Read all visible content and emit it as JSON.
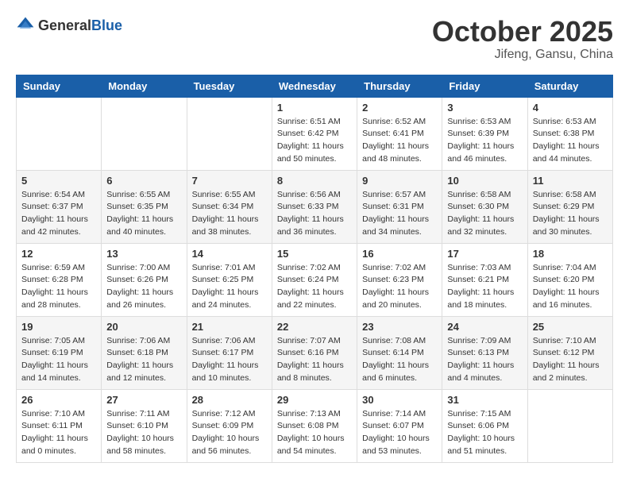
{
  "header": {
    "logo_general": "General",
    "logo_blue": "Blue",
    "month": "October 2025",
    "location": "Jifeng, Gansu, China"
  },
  "weekdays": [
    "Sunday",
    "Monday",
    "Tuesday",
    "Wednesday",
    "Thursday",
    "Friday",
    "Saturday"
  ],
  "weeks": [
    [
      {
        "day": "",
        "sunrise": "",
        "sunset": "",
        "daylight": ""
      },
      {
        "day": "",
        "sunrise": "",
        "sunset": "",
        "daylight": ""
      },
      {
        "day": "",
        "sunrise": "",
        "sunset": "",
        "daylight": ""
      },
      {
        "day": "1",
        "sunrise": "Sunrise: 6:51 AM",
        "sunset": "Sunset: 6:42 PM",
        "daylight": "Daylight: 11 hours and 50 minutes."
      },
      {
        "day": "2",
        "sunrise": "Sunrise: 6:52 AM",
        "sunset": "Sunset: 6:41 PM",
        "daylight": "Daylight: 11 hours and 48 minutes."
      },
      {
        "day": "3",
        "sunrise": "Sunrise: 6:53 AM",
        "sunset": "Sunset: 6:39 PM",
        "daylight": "Daylight: 11 hours and 46 minutes."
      },
      {
        "day": "4",
        "sunrise": "Sunrise: 6:53 AM",
        "sunset": "Sunset: 6:38 PM",
        "daylight": "Daylight: 11 hours and 44 minutes."
      }
    ],
    [
      {
        "day": "5",
        "sunrise": "Sunrise: 6:54 AM",
        "sunset": "Sunset: 6:37 PM",
        "daylight": "Daylight: 11 hours and 42 minutes."
      },
      {
        "day": "6",
        "sunrise": "Sunrise: 6:55 AM",
        "sunset": "Sunset: 6:35 PM",
        "daylight": "Daylight: 11 hours and 40 minutes."
      },
      {
        "day": "7",
        "sunrise": "Sunrise: 6:55 AM",
        "sunset": "Sunset: 6:34 PM",
        "daylight": "Daylight: 11 hours and 38 minutes."
      },
      {
        "day": "8",
        "sunrise": "Sunrise: 6:56 AM",
        "sunset": "Sunset: 6:33 PM",
        "daylight": "Daylight: 11 hours and 36 minutes."
      },
      {
        "day": "9",
        "sunrise": "Sunrise: 6:57 AM",
        "sunset": "Sunset: 6:31 PM",
        "daylight": "Daylight: 11 hours and 34 minutes."
      },
      {
        "day": "10",
        "sunrise": "Sunrise: 6:58 AM",
        "sunset": "Sunset: 6:30 PM",
        "daylight": "Daylight: 11 hours and 32 minutes."
      },
      {
        "day": "11",
        "sunrise": "Sunrise: 6:58 AM",
        "sunset": "Sunset: 6:29 PM",
        "daylight": "Daylight: 11 hours and 30 minutes."
      }
    ],
    [
      {
        "day": "12",
        "sunrise": "Sunrise: 6:59 AM",
        "sunset": "Sunset: 6:28 PM",
        "daylight": "Daylight: 11 hours and 28 minutes."
      },
      {
        "day": "13",
        "sunrise": "Sunrise: 7:00 AM",
        "sunset": "Sunset: 6:26 PM",
        "daylight": "Daylight: 11 hours and 26 minutes."
      },
      {
        "day": "14",
        "sunrise": "Sunrise: 7:01 AM",
        "sunset": "Sunset: 6:25 PM",
        "daylight": "Daylight: 11 hours and 24 minutes."
      },
      {
        "day": "15",
        "sunrise": "Sunrise: 7:02 AM",
        "sunset": "Sunset: 6:24 PM",
        "daylight": "Daylight: 11 hours and 22 minutes."
      },
      {
        "day": "16",
        "sunrise": "Sunrise: 7:02 AM",
        "sunset": "Sunset: 6:23 PM",
        "daylight": "Daylight: 11 hours and 20 minutes."
      },
      {
        "day": "17",
        "sunrise": "Sunrise: 7:03 AM",
        "sunset": "Sunset: 6:21 PM",
        "daylight": "Daylight: 11 hours and 18 minutes."
      },
      {
        "day": "18",
        "sunrise": "Sunrise: 7:04 AM",
        "sunset": "Sunset: 6:20 PM",
        "daylight": "Daylight: 11 hours and 16 minutes."
      }
    ],
    [
      {
        "day": "19",
        "sunrise": "Sunrise: 7:05 AM",
        "sunset": "Sunset: 6:19 PM",
        "daylight": "Daylight: 11 hours and 14 minutes."
      },
      {
        "day": "20",
        "sunrise": "Sunrise: 7:06 AM",
        "sunset": "Sunset: 6:18 PM",
        "daylight": "Daylight: 11 hours and 12 minutes."
      },
      {
        "day": "21",
        "sunrise": "Sunrise: 7:06 AM",
        "sunset": "Sunset: 6:17 PM",
        "daylight": "Daylight: 11 hours and 10 minutes."
      },
      {
        "day": "22",
        "sunrise": "Sunrise: 7:07 AM",
        "sunset": "Sunset: 6:16 PM",
        "daylight": "Daylight: 11 hours and 8 minutes."
      },
      {
        "day": "23",
        "sunrise": "Sunrise: 7:08 AM",
        "sunset": "Sunset: 6:14 PM",
        "daylight": "Daylight: 11 hours and 6 minutes."
      },
      {
        "day": "24",
        "sunrise": "Sunrise: 7:09 AM",
        "sunset": "Sunset: 6:13 PM",
        "daylight": "Daylight: 11 hours and 4 minutes."
      },
      {
        "day": "25",
        "sunrise": "Sunrise: 7:10 AM",
        "sunset": "Sunset: 6:12 PM",
        "daylight": "Daylight: 11 hours and 2 minutes."
      }
    ],
    [
      {
        "day": "26",
        "sunrise": "Sunrise: 7:10 AM",
        "sunset": "Sunset: 6:11 PM",
        "daylight": "Daylight: 11 hours and 0 minutes."
      },
      {
        "day": "27",
        "sunrise": "Sunrise: 7:11 AM",
        "sunset": "Sunset: 6:10 PM",
        "daylight": "Daylight: 10 hours and 58 minutes."
      },
      {
        "day": "28",
        "sunrise": "Sunrise: 7:12 AM",
        "sunset": "Sunset: 6:09 PM",
        "daylight": "Daylight: 10 hours and 56 minutes."
      },
      {
        "day": "29",
        "sunrise": "Sunrise: 7:13 AM",
        "sunset": "Sunset: 6:08 PM",
        "daylight": "Daylight: 10 hours and 54 minutes."
      },
      {
        "day": "30",
        "sunrise": "Sunrise: 7:14 AM",
        "sunset": "Sunset: 6:07 PM",
        "daylight": "Daylight: 10 hours and 53 minutes."
      },
      {
        "day": "31",
        "sunrise": "Sunrise: 7:15 AM",
        "sunset": "Sunset: 6:06 PM",
        "daylight": "Daylight: 10 hours and 51 minutes."
      },
      {
        "day": "",
        "sunrise": "",
        "sunset": "",
        "daylight": ""
      }
    ]
  ]
}
